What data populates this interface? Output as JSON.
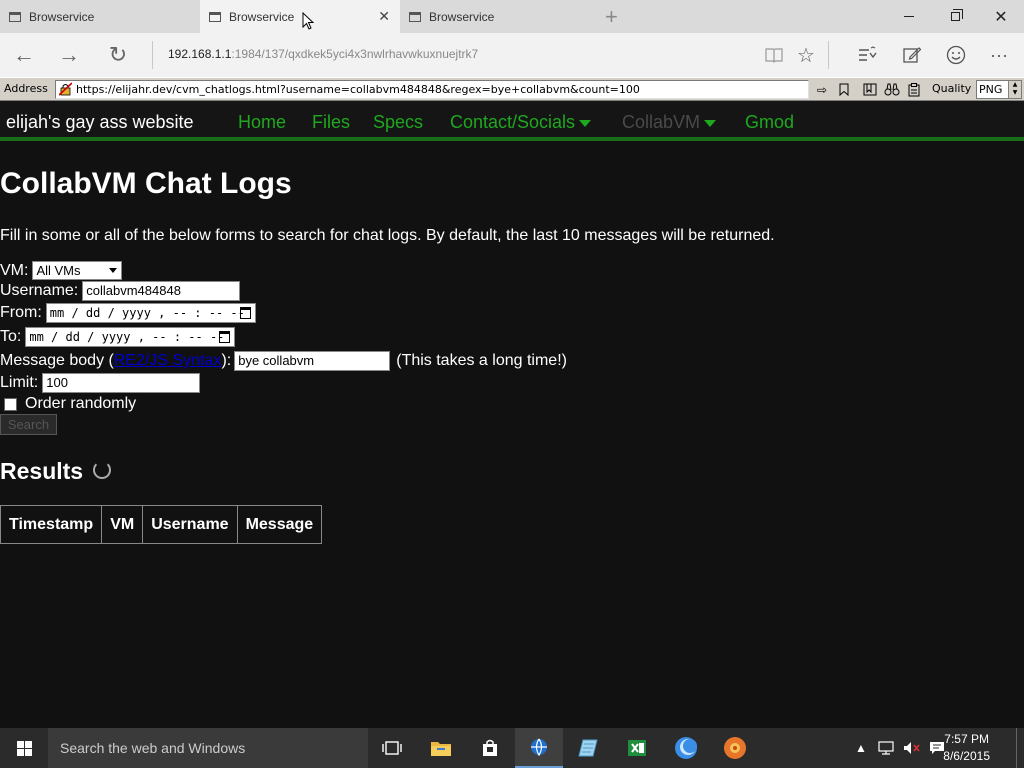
{
  "tabs": [
    {
      "label": "Browservice",
      "active": false
    },
    {
      "label": "Browservice",
      "active": true
    },
    {
      "label": "Browservice",
      "active": false
    }
  ],
  "edge": {
    "url_host": "192.168.1.1",
    "url_rest": ":1984/137/qxdkek5yci4x3nwlrhavwkuxnuejtrk7"
  },
  "browservice": {
    "address_label": "Address",
    "address_url": "https://elijahr.dev/cvm_chatlogs.html?username=collabvm484848&regex=bye+collabvm&count=100",
    "quality_label": "Quality",
    "quality_value": "PNG"
  },
  "site": {
    "name": "elijah's gay ass website",
    "nav": [
      {
        "label": "Home",
        "dropdown": false,
        "active": false
      },
      {
        "label": "Files",
        "dropdown": false,
        "active": false
      },
      {
        "label": "Specs",
        "dropdown": false,
        "active": false
      },
      {
        "label": "Contact/Socials",
        "dropdown": true,
        "active": false
      },
      {
        "label": "CollabVM",
        "dropdown": true,
        "active": true
      },
      {
        "label": "Gmod",
        "dropdown": false,
        "active": false
      }
    ],
    "accent_color": "#1fa81f"
  },
  "page": {
    "title": "CollabVM Chat Logs",
    "intro": "Fill in some or all of the below forms to search for chat logs. By default, the last 10 messages will be returned.",
    "form": {
      "vm_label": "VM:",
      "vm_value": "All VMs",
      "username_label": "Username:",
      "username_value": "collabvm484848",
      "from_label": "From:",
      "from_placeholder": "mm / dd / yyyy ,  -- : --  --",
      "to_label": "To:",
      "to_placeholder": "mm / dd / yyyy ,  -- : --  --",
      "message_label_pre": "Message body (",
      "message_link": "RE2/JS Syntax",
      "message_label_post": "):",
      "message_value": "bye collabvm",
      "message_note": "(This takes a long time!)",
      "limit_label": "Limit:",
      "limit_value": "100",
      "random_label": "Order randomly",
      "search_label": "Search"
    },
    "results_title": "Results",
    "table_headers": [
      "Timestamp",
      "VM",
      "Username",
      "Message"
    ]
  },
  "taskbar": {
    "search_placeholder": "Search the web and Windows",
    "time": "7:57 PM",
    "date": "8/6/2015"
  }
}
